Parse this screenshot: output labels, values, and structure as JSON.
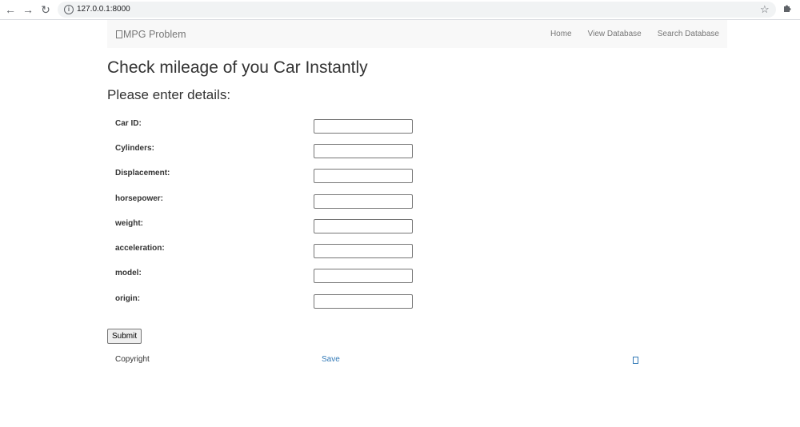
{
  "browser": {
    "url": "127.0.0.1:8000"
  },
  "navbar": {
    "brand": "MPG Problem",
    "links": [
      "Home",
      "View Database",
      "Search Database"
    ]
  },
  "page": {
    "title": "Check mileage of you Car Instantly",
    "subtitle": "Please enter details:"
  },
  "form": {
    "fields": [
      {
        "label": "Car ID:",
        "value": ""
      },
      {
        "label": "Cylinders:",
        "value": ""
      },
      {
        "label": "Displacement:",
        "value": ""
      },
      {
        "label": "horsepower:",
        "value": ""
      },
      {
        "label": "weight:",
        "value": ""
      },
      {
        "label": "acceleration:",
        "value": ""
      },
      {
        "label": "model:",
        "value": ""
      },
      {
        "label": "origin:",
        "value": ""
      }
    ],
    "submit_label": "Submit"
  },
  "footer": {
    "copyright": "Copyright",
    "save_link": "Save"
  }
}
